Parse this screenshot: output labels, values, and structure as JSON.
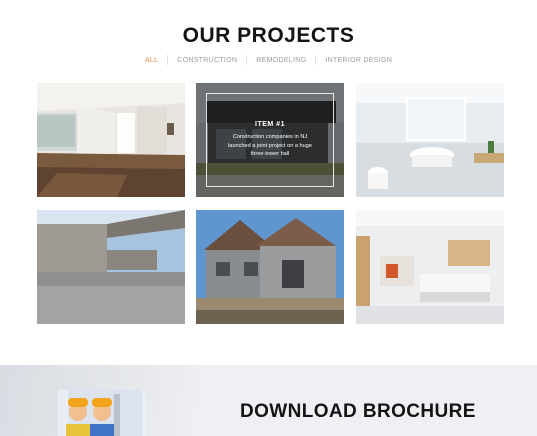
{
  "section": {
    "title": "OUR PROJECTS"
  },
  "filters": [
    {
      "label": "ALL",
      "active": true
    },
    {
      "label": "CONSTRUCTION",
      "active": false
    },
    {
      "label": "REMODELING",
      "active": false
    },
    {
      "label": "INTERIOR DESIGN",
      "active": false
    }
  ],
  "projects": [
    {
      "image": "empty-apartment-interior-photo"
    },
    {
      "image": "modern-house-exterior-photo",
      "overlay": {
        "title": "ITEM #1",
        "description": "Construction companies in NJ launched a joint project on a huge three-tower hall"
      }
    },
    {
      "image": "white-bathroom-photo"
    },
    {
      "image": "concrete-architecture-photo"
    },
    {
      "image": "house-under-construction-photo"
    },
    {
      "image": "modern-kitchen-photo"
    }
  ],
  "brochure": {
    "title": "DOWNLOAD BROCHURE",
    "image": "workers-brochure-photo"
  },
  "colors": {
    "accent": "#e58a3c",
    "text": "#141414",
    "muted": "#9b9b9b",
    "band": "#eef0f3"
  }
}
